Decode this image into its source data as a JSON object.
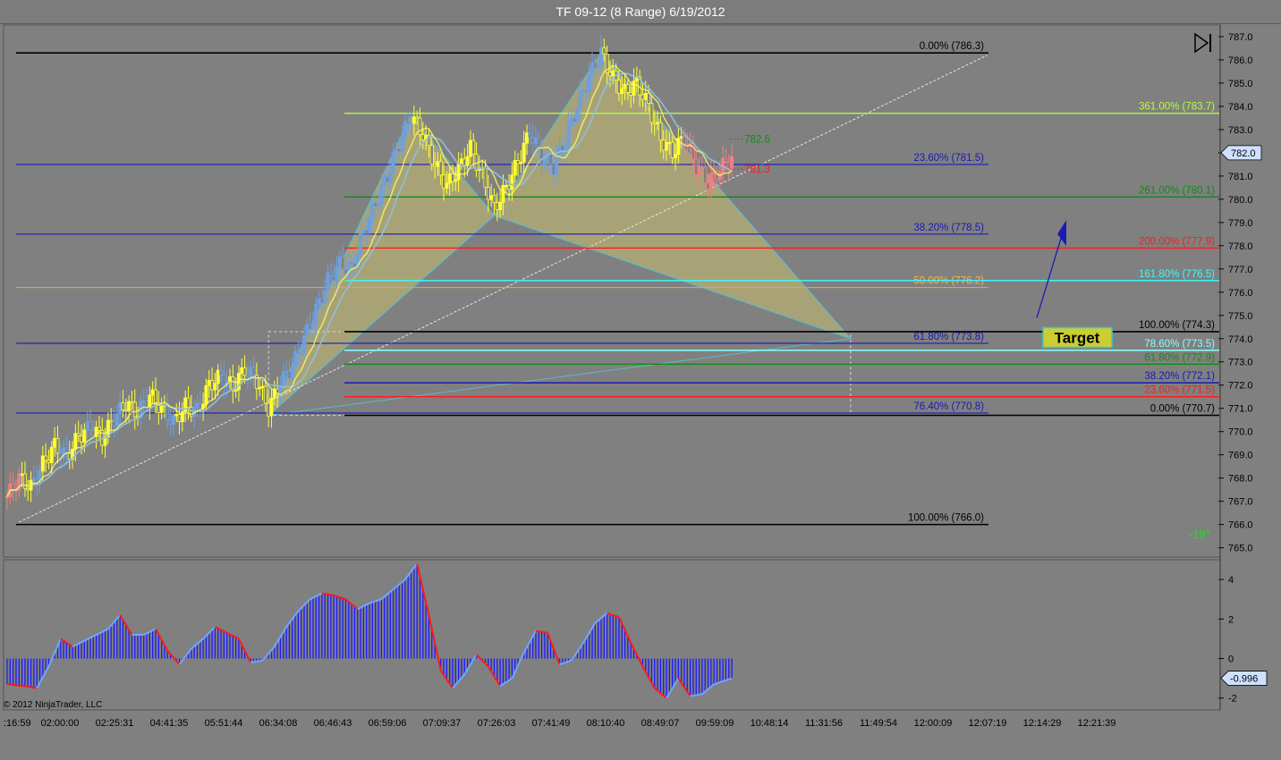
{
  "window": {
    "title": "TF 09-12 (8 Range)  6/19/2012"
  },
  "copyright": "© 2012 NinjaTrader, LLC",
  "icons": {
    "scroll_end": "skip-to-end-icon"
  },
  "colors": {
    "background": "#808080",
    "up_candle": "#ffff33",
    "down_candle": "#ffff33",
    "blue_candle": "#6f9fdf",
    "red_candle": "#f08080",
    "histogram": "#1a1aff",
    "price_tag": "#cfe0ff"
  },
  "chart_data": [
    {
      "type": "candlestick",
      "title": "TF 09-12 (8 Range)  6/19/2012",
      "ylim": [
        764.6,
        787.5
      ],
      "yticks": [
        "787.0",
        "786.0",
        "785.0",
        "784.0",
        "783.0",
        "782.0",
        "781.0",
        "780.0",
        "779.0",
        "778.0",
        "777.0",
        "776.0",
        "775.0",
        "774.0",
        "773.0",
        "772.0",
        "771.0",
        "770.0",
        "769.0",
        "768.0",
        "767.0",
        "766.0",
        "765.0"
      ],
      "xticks": [
        ":16:59",
        "02:00:00",
        "02:25:31",
        "04:41:35",
        "05:51:44",
        "06:34:08",
        "06:46:43",
        "06:59:06",
        "07:09:37",
        "07:26:03",
        "07:41:49",
        "08:10:40",
        "08:49:07",
        "09:59:09",
        "10:48:14",
        "11:31:56",
        "11:49:54",
        "12:00:09",
        "12:07:19",
        "12:14:29",
        "12:21:39"
      ],
      "last_price": "782.0",
      "close_path": [
        [
          0,
          767.2
        ],
        [
          4,
          768.0
        ],
        [
          8,
          767.6
        ],
        [
          12,
          768.6
        ],
        [
          16,
          769.4
        ],
        [
          20,
          768.9
        ],
        [
          24,
          769.8
        ],
        [
          28,
          770.2
        ],
        [
          32,
          769.7
        ],
        [
          36,
          770.6
        ],
        [
          40,
          771.2
        ],
        [
          44,
          770.8
        ],
        [
          48,
          771.6
        ],
        [
          52,
          771.0
        ],
        [
          56,
          770.4
        ],
        [
          60,
          771.1
        ],
        [
          64,
          770.9
        ],
        [
          68,
          772.0
        ],
        [
          72,
          772.4
        ],
        [
          76,
          771.9
        ],
        [
          80,
          772.7
        ],
        [
          84,
          772.2
        ],
        [
          88,
          771.0
        ],
        [
          92,
          772.1
        ],
        [
          96,
          772.8
        ],
        [
          100,
          774.0
        ],
        [
          104,
          775.2
        ],
        [
          108,
          776.5
        ],
        [
          112,
          777.2
        ],
        [
          116,
          777.0
        ],
        [
          120,
          778.6
        ],
        [
          124,
          779.8
        ],
        [
          128,
          781.0
        ],
        [
          132,
          782.4
        ],
        [
          136,
          783.6
        ],
        [
          140,
          782.8
        ],
        [
          144,
          781.5
        ],
        [
          148,
          780.6
        ],
        [
          152,
          781.3
        ],
        [
          156,
          782.2
        ],
        [
          160,
          781.0
        ],
        [
          164,
          779.6
        ],
        [
          168,
          780.5
        ],
        [
          172,
          781.6
        ],
        [
          176,
          782.9
        ],
        [
          180,
          781.8
        ],
        [
          184,
          781.4
        ],
        [
          188,
          782.6
        ],
        [
          192,
          784.0
        ],
        [
          196,
          785.3
        ],
        [
          200,
          786.3
        ],
        [
          204,
          785.2
        ],
        [
          208,
          784.6
        ],
        [
          212,
          785.0
        ],
        [
          216,
          784.0
        ],
        [
          220,
          782.6
        ],
        [
          224,
          782.0
        ],
        [
          228,
          782.7
        ],
        [
          232,
          781.4
        ],
        [
          236,
          780.7
        ],
        [
          240,
          781.3
        ],
        [
          244,
          781.8
        ]
      ],
      "fib_left": [
        {
          "label": "0.00% (786.3)",
          "price": 786.3,
          "color": "#000000"
        },
        {
          "label": "23.60% (781.5)",
          "price": 781.5,
          "color": "#1a1ab3"
        },
        {
          "label": "38.20% (778.5)",
          "price": 778.5,
          "color": "#1a1ab3"
        },
        {
          "label": "50.00% (776.2)",
          "price": 776.2,
          "color": "#ff9933"
        },
        {
          "label": "61.80% (773.8)",
          "price": 773.8,
          "color": "#1a1ab3"
        },
        {
          "label": "76.40% (770.8)",
          "price": 770.8,
          "color": "#1a1ab3"
        },
        {
          "label": "100.00% (766.0)",
          "price": 766.0,
          "color": "#000000"
        }
      ],
      "fib_right": [
        {
          "label": "361.00% (783.7)",
          "price": 783.7,
          "color": "#b5ff3a"
        },
        {
          "label": "261.00% (780.1)",
          "price": 780.1,
          "color": "#138a13"
        },
        {
          "label": "200.00% (777.9)",
          "price": 777.9,
          "color": "#ff1a1a"
        },
        {
          "label": "161.80% (776.5)",
          "price": 776.5,
          "color": "#33ffff"
        },
        {
          "label": "100.00% (774.3)",
          "price": 774.3,
          "color": "#000000"
        },
        {
          "label": "78.60% (773.5)",
          "price": 773.5,
          "color": "#88ffff"
        },
        {
          "label": "61.80% (772.9)",
          "price": 772.9,
          "color": "#138a13"
        },
        {
          "label": "38.20% (772.1)",
          "price": 772.1,
          "color": "#1a1ab3"
        },
        {
          "label": "23.60% (771.5)",
          "price": 771.5,
          "color": "#ff1a1a"
        },
        {
          "label": "0.00% (770.7)",
          "price": 770.7,
          "color": "#000000"
        }
      ],
      "annotations": {
        "level_high": "782.6",
        "level_low": "781.3",
        "target": "Target",
        "angle": "-19°"
      },
      "pattern_points": [
        {
          "bar": 88,
          "price": 770.7
        },
        {
          "bar": 136,
          "price": 783.6
        },
        {
          "bar": 164,
          "price": 779.3
        },
        {
          "bar": 200,
          "price": 786.3
        },
        {
          "bar": 284,
          "price": 774.0
        }
      ]
    },
    {
      "type": "bar",
      "title": "",
      "ylim": [
        -2.6,
        5.0
      ],
      "yticks": [
        "4",
        "2",
        "0",
        "-2"
      ],
      "last_value": "-0.996",
      "values_path": [
        [
          0,
          -1.3
        ],
        [
          6,
          -1.4
        ],
        [
          10,
          -1.5
        ],
        [
          14,
          -0.4
        ],
        [
          18,
          1.0
        ],
        [
          22,
          0.6
        ],
        [
          26,
          0.9
        ],
        [
          30,
          1.2
        ],
        [
          34,
          1.5
        ],
        [
          38,
          2.2
        ],
        [
          42,
          1.2
        ],
        [
          46,
          1.2
        ],
        [
          50,
          1.5
        ],
        [
          54,
          0.4
        ],
        [
          58,
          -0.3
        ],
        [
          62,
          0.5
        ],
        [
          66,
          1.0
        ],
        [
          70,
          1.6
        ],
        [
          74,
          1.3
        ],
        [
          78,
          1.0
        ],
        [
          82,
          -0.2
        ],
        [
          86,
          -0.1
        ],
        [
          90,
          0.6
        ],
        [
          94,
          1.6
        ],
        [
          98,
          2.4
        ],
        [
          102,
          3.0
        ],
        [
          106,
          3.3
        ],
        [
          110,
          3.2
        ],
        [
          114,
          3.0
        ],
        [
          118,
          2.5
        ],
        [
          122,
          2.8
        ],
        [
          126,
          3.0
        ],
        [
          130,
          3.5
        ],
        [
          134,
          4.0
        ],
        [
          138,
          4.8
        ],
        [
          142,
          2.2
        ],
        [
          146,
          -0.6
        ],
        [
          150,
          -1.5
        ],
        [
          154,
          -0.8
        ],
        [
          158,
          0.2
        ],
        [
          162,
          -0.4
        ],
        [
          166,
          -1.4
        ],
        [
          170,
          -1.0
        ],
        [
          174,
          0.3
        ],
        [
          178,
          1.4
        ],
        [
          182,
          1.3
        ],
        [
          186,
          -0.3
        ],
        [
          190,
          -0.1
        ],
        [
          194,
          0.8
        ],
        [
          198,
          1.8
        ],
        [
          202,
          2.3
        ],
        [
          206,
          2.1
        ],
        [
          210,
          0.8
        ],
        [
          214,
          -0.4
        ],
        [
          218,
          -1.5
        ],
        [
          222,
          -2.0
        ],
        [
          226,
          -1.0
        ],
        [
          230,
          -1.9
        ],
        [
          234,
          -1.8
        ],
        [
          238,
          -1.3
        ],
        [
          244,
          -1.0
        ]
      ]
    }
  ]
}
